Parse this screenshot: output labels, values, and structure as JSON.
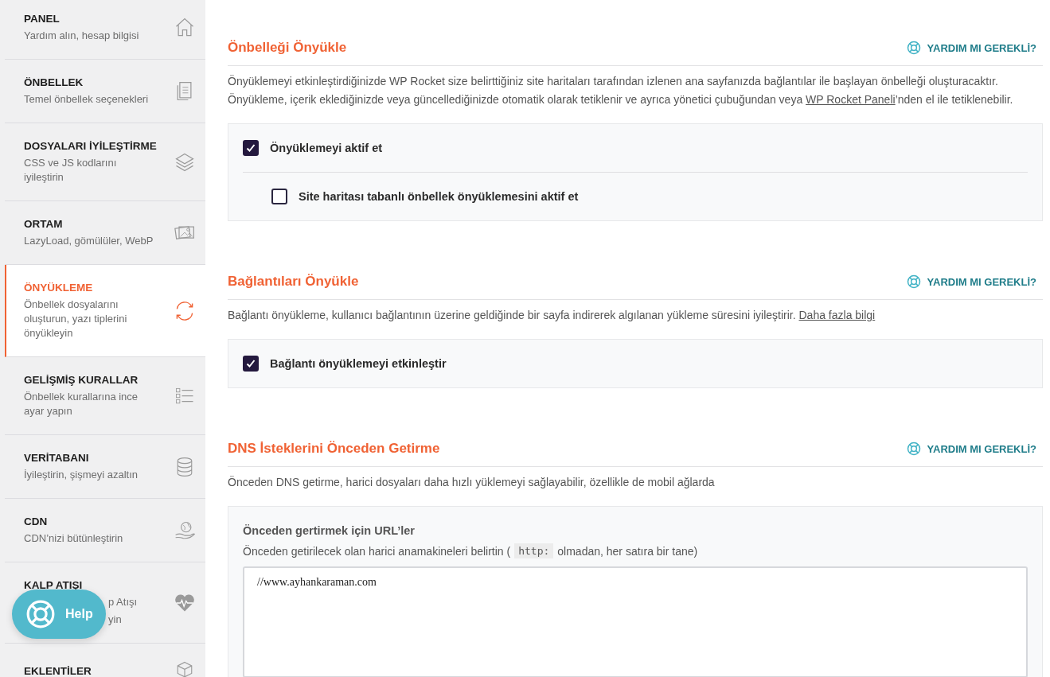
{
  "sidebar": {
    "items": [
      {
        "title": "PANEL",
        "subtitle": "Yardım alın, hesap bilgisi",
        "selected": false
      },
      {
        "title": "ÖNBELLEK",
        "subtitle": "Temel önbellek seçenekleri",
        "selected": false
      },
      {
        "title": "DOSYALARI İYİLEŞTİRME",
        "subtitle": "CSS ve JS kodlarını iyileştirin",
        "selected": false
      },
      {
        "title": "ORTAM",
        "subtitle": "LazyLoad, gömülüler, WebP",
        "selected": false
      },
      {
        "title": "ÖNYÜKLEME",
        "subtitle": "Önbellek dosyalarını oluşturun, yazı tiplerini önyükleyin",
        "selected": true
      },
      {
        "title": "GELİŞMİŞ KURALLAR",
        "subtitle": "Önbellek kurallarına ince ayar yapın",
        "selected": false
      },
      {
        "title": "VERİTABANI",
        "subtitle": "İyileştirin, şişmeyi azaltın",
        "selected": false
      },
      {
        "title": "CDN",
        "subtitle": "CDN’nizi bütünleştirin",
        "selected": false
      },
      {
        "title": "KALP ATIŞI",
        "subtitle_parts": [
          "p Atışı",
          "yin"
        ],
        "selected": false
      },
      {
        "title": "EKLENTİLER",
        "selected": false
      }
    ]
  },
  "help_button": {
    "label": "Help"
  },
  "sections": [
    {
      "title": "Önbelleği Önyükle",
      "help_link": "YARDIM MI GEREKLİ?",
      "description": {
        "text": "Önyüklemeyi etkinleştirdiğinizde WP Rocket size belirttiğiniz site haritaları tarafından izlenen ana sayfanızda bağlantılar ile başlayan önbelleği oluşturacaktır. Önyükleme, içerik eklediğinizde veya güncellediğinizde otomatik olarak tetiklenir ve ayrıca yönetici çubuğundan veya ",
        "link": "WP Rocket Paneli",
        "after": "’nden el ile tetiklenebilir."
      },
      "options": [
        {
          "label": "Önyüklemeyi aktif et",
          "checked": true,
          "children": [
            {
              "label": "Site haritası tabanlı önbellek önyüklemesini aktif et",
              "checked": false
            }
          ]
        }
      ]
    },
    {
      "title": "Bağlantıları Önyükle",
      "help_link": "YARDIM MI GEREKLİ?",
      "description": {
        "text": "Bağlantı önyükleme, kullanıcı bağlantının üzerine geldiğinde bir sayfa indirerek algılanan yükleme süresini iyileştirir. ",
        "link": "Daha fazla bilgi"
      },
      "options": [
        {
          "label": "Bağlantı önyüklemeyi etkinleştir",
          "checked": true
        }
      ]
    },
    {
      "title": "DNS İsteklerini Önceden Getirme",
      "help_link": "YARDIM MI GEREKLİ?",
      "description": {
        "text": "Önceden DNS getirme, harici dosyaları daha hızlı yüklemeyi sağlayabilir, özellikle de mobil ağlarda"
      },
      "field": {
        "label": "Önceden gertirmek için URL’ler",
        "hint_before": "Önceden getirilecek olan harici anamakineleri belirtin (",
        "hint_code": "http:",
        "hint_after": "olmadan, her satıra bir tane)",
        "value": "//www.ayhankaraman.com"
      }
    }
  ]
}
